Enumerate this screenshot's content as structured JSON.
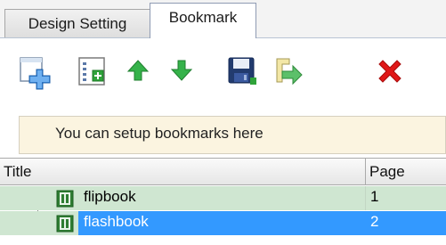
{
  "tabs": [
    {
      "label": "Design Setting",
      "active": false
    },
    {
      "label": "Bookmark",
      "active": true
    }
  ],
  "toolbar": {
    "buttons": [
      {
        "icon": "add-bookmark-icon"
      },
      {
        "icon": "add-child-bookmark-icon"
      },
      {
        "icon": "move-up-icon"
      },
      {
        "icon": "move-down-icon"
      },
      {
        "icon": "save-icon"
      },
      {
        "icon": "import-icon"
      },
      {
        "icon": "delete-icon"
      }
    ]
  },
  "info": {
    "text": "You can setup bookmarks here"
  },
  "table": {
    "columns": [
      "Title",
      "Page"
    ],
    "rows": [
      {
        "title": "flipbook",
        "page": "1",
        "selected": false
      },
      {
        "title": "flashbook",
        "page": "2",
        "selected": true
      }
    ]
  },
  "colors": {
    "row_bg": "#cfe6d1",
    "selection": "#3399ff",
    "info_bg": "#fbf4e0",
    "delete_red": "#e01818"
  }
}
